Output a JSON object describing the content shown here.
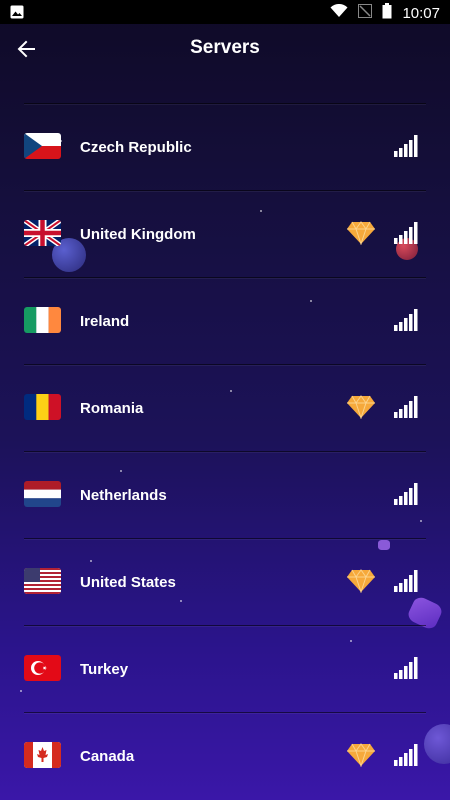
{
  "status_bar": {
    "time": "10:07"
  },
  "header": {
    "title": "Servers"
  },
  "servers": [
    {
      "country": "Czech Republic",
      "premium": false
    },
    {
      "country": "United Kingdom",
      "premium": true
    },
    {
      "country": "Ireland",
      "premium": false
    },
    {
      "country": "Romania",
      "premium": true
    },
    {
      "country": "Netherlands",
      "premium": false
    },
    {
      "country": "United States",
      "premium": true
    },
    {
      "country": "Turkey",
      "premium": false
    },
    {
      "country": "Canada",
      "premium": true
    }
  ],
  "icons": {
    "back": "arrow-left-icon",
    "premium": "diamond-icon",
    "signal": "signal-strength-icon"
  },
  "colors": {
    "premium_diamond": "#f6a93b",
    "background_top": "#0f0a26",
    "background_bottom": "#3a17a8"
  }
}
